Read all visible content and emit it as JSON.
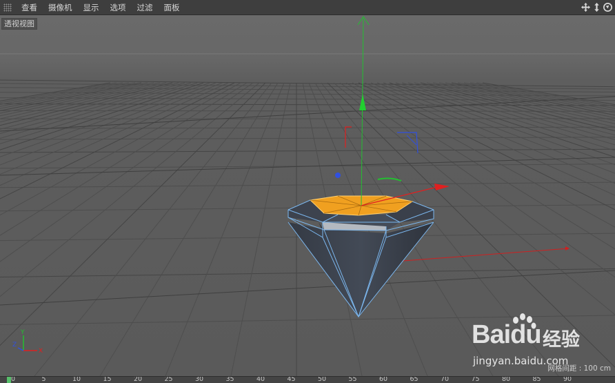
{
  "menu": {
    "items": [
      "查看",
      "摄像机",
      "显示",
      "选项",
      "过滤",
      "面板"
    ]
  },
  "nav_icons": [
    "move-view-icon",
    "dolly-view-icon",
    "rotate-view-icon"
  ],
  "viewport": {
    "label": "透视视图",
    "grid_spacing": "网格间距 : 100 cm",
    "colors": {
      "background": "#5f5f5f",
      "grid": "#4a4a4a",
      "object_fill": "#3c424d",
      "edge": "#7cb8f0",
      "selected_polygon": "#f0a020",
      "axis_x": "#e02020",
      "axis_y": "#22c030",
      "axis_z": "#2040e0"
    }
  },
  "axis_indicator": {
    "x": "X",
    "y": "Y",
    "z": "Z"
  },
  "watermark": {
    "logo": "Bai",
    "logo_tail": "du",
    "brand": "经验",
    "url": "jingyan.baidu.com"
  },
  "timeline": {
    "ticks": [
      "0",
      "5",
      "10",
      "15",
      "20",
      "25",
      "30",
      "35",
      "40",
      "45",
      "50",
      "55",
      "60",
      "65",
      "70",
      "75",
      "80",
      "85",
      "90"
    ]
  }
}
